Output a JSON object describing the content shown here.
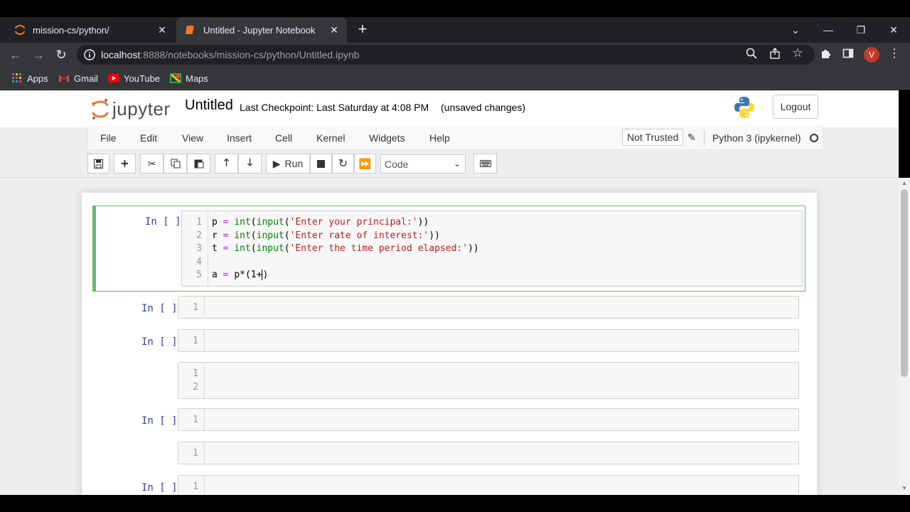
{
  "browser": {
    "tabs": [
      {
        "title": "mission-cs/python/",
        "active": false
      },
      {
        "title": "Untitled - Jupyter Notebook",
        "active": true
      }
    ],
    "url_host": "localhost",
    "url_rest": ":8888/notebooks/mission-cs/python/Untitled.ipynb",
    "profile_initial": "V",
    "bookmarks": [
      "Apps",
      "Gmail",
      "YouTube",
      "Maps"
    ]
  },
  "jupyter": {
    "logo_text": "jupyter",
    "notebook_name": "Untitled",
    "checkpoint": "Last Checkpoint: Last Saturday at 4:08 PM",
    "autosave": "(unsaved changes)",
    "logout_label": "Logout",
    "menus": [
      "File",
      "Edit",
      "View",
      "Insert",
      "Cell",
      "Kernel",
      "Widgets",
      "Help"
    ],
    "trust_label": "Not Trusted",
    "kernel_name": "Python 3 (ipykernel)",
    "run_label": "Run",
    "cell_type": "Code"
  },
  "cells": [
    {
      "prompt": "In [ ]:",
      "lines": [
        "1",
        "2",
        "3",
        "4",
        "5"
      ]
    },
    {
      "prompt": "In [ ]:",
      "lines": [
        "1"
      ]
    },
    {
      "prompt": "In [ ]:",
      "lines": [
        "1"
      ]
    },
    {
      "prompt": "",
      "lines": [
        "1",
        "2"
      ]
    },
    {
      "prompt": "In [ ]:",
      "lines": [
        "1"
      ]
    },
    {
      "prompt": "",
      "lines": [
        "1"
      ]
    },
    {
      "prompt": "In [ ]:",
      "lines": [
        "1"
      ]
    }
  ],
  "code": {
    "line1_var": "p",
    "line1_op": "=",
    "line1_fn": "int",
    "line1_fn2": "input",
    "line1_str": "'Enter your principal:'",
    "line2_var": "r",
    "line2_op": "=",
    "line2_fn": "int",
    "line2_fn2": "input",
    "line2_str": "'Enter rate of interest:'",
    "line3_var": "t",
    "line3_op": "=",
    "line3_fn": "int",
    "line3_fn2": "input",
    "line3_str": "'Enter the time period elapsed:'",
    "line5_var": "a",
    "line5_op": "=",
    "line5_rest": "p*(1+"
  },
  "colors": {
    "selected_cell_border": "#66bb6a",
    "prompt": "#303f9f",
    "string": "#ba2121",
    "builtin": "#008000"
  }
}
